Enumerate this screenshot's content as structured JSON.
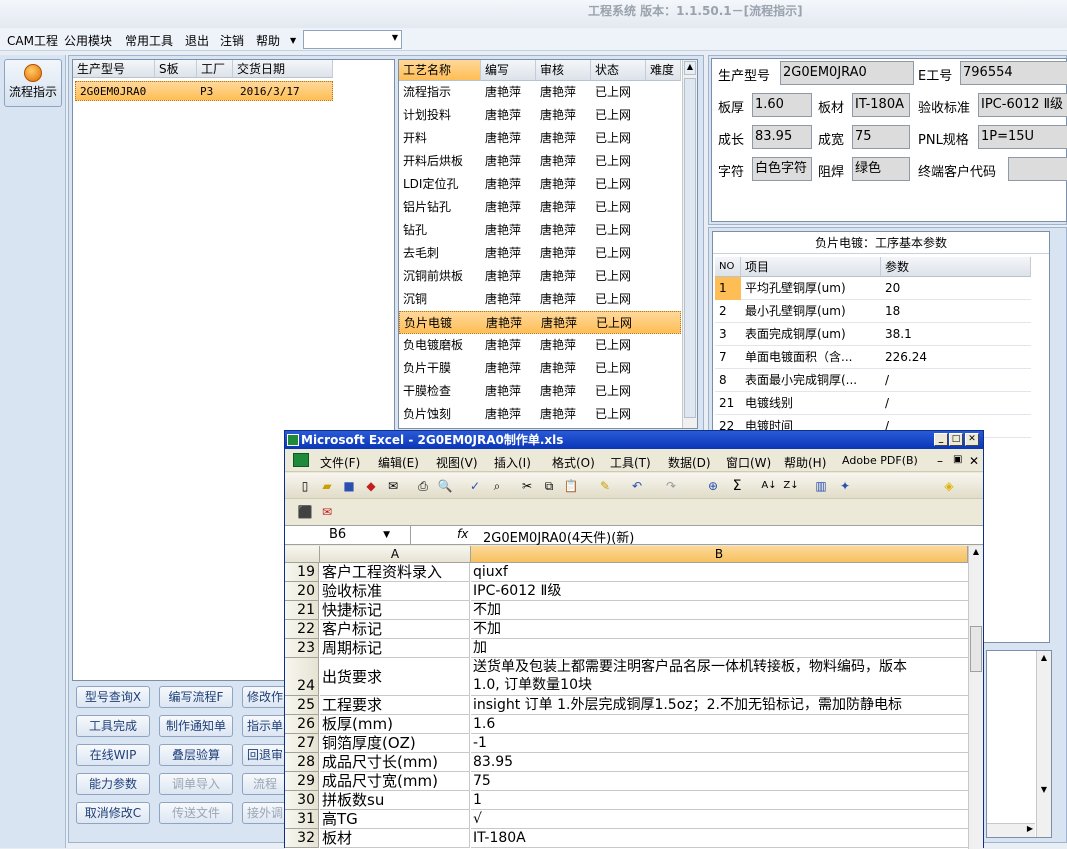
{
  "app": {
    "title": "工程系统 版本：1.1.50.1－[流程指示]"
  },
  "menu": {
    "items": [
      "CAM工程",
      "公用模块",
      "常用工具",
      "退出",
      "注销",
      "帮助"
    ],
    "dropdown_value": ""
  },
  "leftbar": {
    "flow_button": "流程指示"
  },
  "orders": {
    "headers": [
      "生产型号",
      "S板",
      "工厂",
      "交货日期"
    ],
    "rows": [
      [
        "2G0EM0JRA0",
        "",
        "P3",
        "2016/3/17"
      ]
    ]
  },
  "process": {
    "headers": [
      "工艺名称",
      "编写",
      "审核",
      "状态",
      "难度"
    ],
    "rows": [
      [
        "流程指示",
        "唐艳萍",
        "唐艳萍",
        "已上网",
        ""
      ],
      [
        "计划投料",
        "唐艳萍",
        "唐艳萍",
        "已上网",
        ""
      ],
      [
        "开料",
        "唐艳萍",
        "唐艳萍",
        "已上网",
        ""
      ],
      [
        "开料后烘板",
        "唐艳萍",
        "唐艳萍",
        "已上网",
        ""
      ],
      [
        "LDI定位孔",
        "唐艳萍",
        "唐艳萍",
        "已上网",
        ""
      ],
      [
        "铝片钻孔",
        "唐艳萍",
        "唐艳萍",
        "已上网",
        ""
      ],
      [
        "钻孔",
        "唐艳萍",
        "唐艳萍",
        "已上网",
        ""
      ],
      [
        "去毛刺",
        "唐艳萍",
        "唐艳萍",
        "已上网",
        ""
      ],
      [
        "沉铜前烘板",
        "唐艳萍",
        "唐艳萍",
        "已上网",
        ""
      ],
      [
        "沉铜",
        "唐艳萍",
        "唐艳萍",
        "已上网",
        ""
      ],
      [
        "负片电镀",
        "唐艳萍",
        "唐艳萍",
        "已上网",
        ""
      ],
      [
        "负电镀磨板",
        "唐艳萍",
        "唐艳萍",
        "已上网",
        ""
      ],
      [
        "负片干膜",
        "唐艳萍",
        "唐艳萍",
        "已上网",
        ""
      ],
      [
        "干膜检查",
        "唐艳萍",
        "唐艳萍",
        "已上网",
        ""
      ],
      [
        "负片蚀刻",
        "唐艳萍",
        "唐艳萍",
        "已上网",
        ""
      ]
    ],
    "selected_index": 10
  },
  "info": {
    "model_label": "生产型号",
    "model": "2G0EM0JRA0",
    "eno_label": "E工号",
    "eno": "796554",
    "thick_label": "板厚",
    "thick": "1.60",
    "mat_label": "板材",
    "mat": "IT-180A",
    "std_label": "验收标准",
    "std": "IPC-6012 Ⅱ级",
    "len_label": "成长",
    "len": "83.95",
    "wid_label": "成宽",
    "wid": "75",
    "pnl_label": "PNL规格",
    "pnl": "1P=15U",
    "char_label": "字符",
    "char": "白色字符",
    "mask_label": "阻焊",
    "mask": "绿色",
    "cust_label": "终端客户代码",
    "cust": ""
  },
  "params": {
    "title": "负片电镀：工序基本参数",
    "headers": [
      "NO",
      "项目",
      "参数"
    ],
    "rows": [
      [
        "1",
        "平均孔壁铜厚(um)",
        "20"
      ],
      [
        "2",
        "最小孔壁铜厚(um)",
        "18"
      ],
      [
        "3",
        "表面完成铜厚(um)",
        "38.1"
      ],
      [
        "7",
        "单面电镀面积（含...",
        "226.24"
      ],
      [
        "8",
        "表面最小完成铜厚(...",
        "/"
      ],
      [
        "21",
        "电镀线别",
        "/"
      ],
      [
        "22",
        "电镀时间",
        "/"
      ]
    ]
  },
  "buttons": [
    [
      "型号查询X",
      "编写流程F",
      "修改作"
    ],
    [
      "工具完成",
      "制作通知单",
      "指示单"
    ],
    [
      "在线WIP",
      "叠层验算",
      "回退审"
    ],
    [
      "能力参数",
      "调单导入",
      "流程"
    ],
    [
      "取消修改C",
      "传送文件",
      "接外调"
    ]
  ],
  "excel": {
    "title": "Microsoft Excel - 2G0EM0JRA0制作单.xls",
    "menu": [
      "文件(F)",
      "编辑(E)",
      "视图(V)",
      "插入(I)",
      "格式(O)",
      "工具(T)",
      "数据(D)",
      "窗口(W)",
      "帮助(H)",
      "Adobe PDF(B)"
    ],
    "namebox": "B6",
    "fx": "fx",
    "formula": "2G0EM0JRA0(4天件)(新)",
    "cols": [
      "A",
      "B"
    ],
    "rows": [
      [
        "19",
        "客户工程资料录入",
        "qiuxf"
      ],
      [
        "20",
        "验收标准",
        "IPC-6012 Ⅱ级"
      ],
      [
        "21",
        "快捷标记",
        "不加"
      ],
      [
        "22",
        "客户标记",
        "不加"
      ],
      [
        "23",
        "周期标记",
        "加"
      ],
      [
        "24",
        "出货要求",
        "送货单及包装上都需要注明客户品名尿一体机转接板，物料编码，版本",
        "1.0, 订单数量10块"
      ],
      [
        "25",
        "工程要求",
        "insight 订单 1.外层完成铜厚1.5oz；2.不加无铅标记，需加防静电标"
      ],
      [
        "26",
        "板厚(mm)",
        "1.6"
      ],
      [
        "27",
        "铜箔厚度(OZ)",
        "-1"
      ],
      [
        "28",
        "成品尺寸长(mm)",
        "83.95"
      ],
      [
        "29",
        "成品尺寸宽(mm)",
        "75"
      ],
      [
        "30",
        "拼板数su",
        "1"
      ],
      [
        "31",
        "高TG",
        "√"
      ],
      [
        "32",
        "板材",
        "IT-180A"
      ]
    ]
  },
  "colors": {
    "accent": "#ffbe55",
    "excel_title": "#0a36b8",
    "panel_border": "#7d8fa8"
  }
}
